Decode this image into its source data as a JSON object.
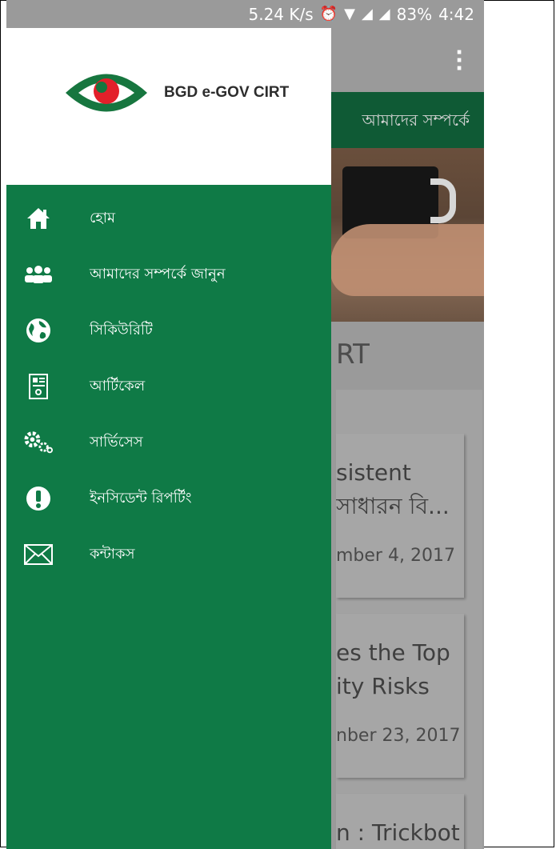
{
  "status_bar": {
    "speed": "5.24 K/s",
    "battery": "83%",
    "time": "4:42",
    "icons": [
      "alarm-icon",
      "wifi-icon",
      "signal-icon",
      "signal-icon"
    ]
  },
  "background": {
    "tab_label": "আমাদের সম্পর্কে",
    "section_heading_partial": "RT",
    "cards": [
      {
        "title_line1": "sistent",
        "title_line2": "সাধারন বি...",
        "date": "mber 4, 2017"
      },
      {
        "title_line1": "es the Top",
        "title_line2": "ity Risks",
        "date": "nber 23, 2017"
      },
      {
        "title_line1": "n : Trickbot",
        "title_line2": "",
        "date": ""
      }
    ]
  },
  "drawer": {
    "logo_text": "BGD e-GOV CIRT",
    "brand_colors": {
      "green": "#0f7a46",
      "red": "#e3202a",
      "logo_green": "#17763f"
    },
    "items": [
      {
        "icon": "home-icon",
        "label": "হোম"
      },
      {
        "icon": "group-icon",
        "label": "আমাদের সম্পর্কে জানুন"
      },
      {
        "icon": "globe-icon",
        "label": "সিকিউরিটি"
      },
      {
        "icon": "article-icon",
        "label": "আর্টিকেল"
      },
      {
        "icon": "gears-icon",
        "label": "সার্ভিসেস"
      },
      {
        "icon": "alert-icon",
        "label": "ইনসিডেন্ট রিপর্টিং"
      },
      {
        "icon": "mail-icon",
        "label": "কন্টাকস"
      }
    ]
  }
}
